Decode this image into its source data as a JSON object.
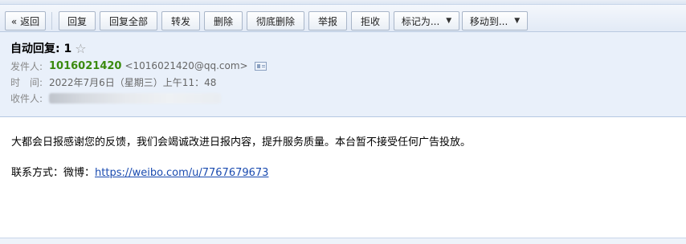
{
  "toolbar": {
    "back": "« 返回",
    "reply": "回复",
    "reply_all": "回复全部",
    "forward": "转发",
    "delete": "删除",
    "delete_permanently": "彻底删除",
    "report": "举报",
    "reject": "拒收",
    "mark_as": "标记为...",
    "move_to": "移动到..."
  },
  "email": {
    "subject": "自动回复: 1",
    "star_icon": "☆",
    "from_label": "发件人:",
    "from_name": "1016021420",
    "from_address": "<1016021420@qq.com>",
    "time_label": "时　间:",
    "time_value": "2022年7月6日（星期三）上午11：48",
    "to_label": "收件人:"
  },
  "body": {
    "paragraph": "大都会日报感谢您的反馈，我们会竭诚改进日报内容，提升服务质量。本台暂不接受任何广告投放。",
    "contact_prefix": "联系方式：微博：",
    "contact_link": "https://weibo.com/u/7767679673"
  }
}
